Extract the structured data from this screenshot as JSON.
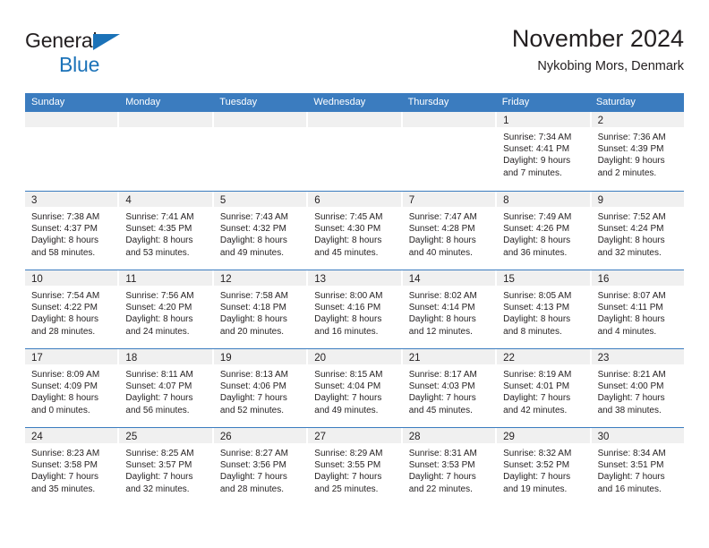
{
  "brand": {
    "name_top": "General",
    "name_bottom": "Blue",
    "triangle_color": "#1b72b8",
    "text_color": "#231f20"
  },
  "header": {
    "title": "November 2024",
    "subtitle": "Nykobing Mors, Denmark",
    "header_bg": "#3b7cbf",
    "header_text_color": "#ffffff",
    "day_band_bg": "#f0f0f0"
  },
  "weekdays": [
    "Sunday",
    "Monday",
    "Tuesday",
    "Wednesday",
    "Thursday",
    "Friday",
    "Saturday"
  ],
  "weeks": [
    [
      {
        "day": "",
        "empty": true
      },
      {
        "day": "",
        "empty": true
      },
      {
        "day": "",
        "empty": true
      },
      {
        "day": "",
        "empty": true
      },
      {
        "day": "",
        "empty": true
      },
      {
        "day": "1",
        "sunrise": "Sunrise: 7:34 AM",
        "sunset": "Sunset: 4:41 PM",
        "daylight1": "Daylight: 9 hours",
        "daylight2": "and 7 minutes."
      },
      {
        "day": "2",
        "sunrise": "Sunrise: 7:36 AM",
        "sunset": "Sunset: 4:39 PM",
        "daylight1": "Daylight: 9 hours",
        "daylight2": "and 2 minutes."
      }
    ],
    [
      {
        "day": "3",
        "sunrise": "Sunrise: 7:38 AM",
        "sunset": "Sunset: 4:37 PM",
        "daylight1": "Daylight: 8 hours",
        "daylight2": "and 58 minutes."
      },
      {
        "day": "4",
        "sunrise": "Sunrise: 7:41 AM",
        "sunset": "Sunset: 4:35 PM",
        "daylight1": "Daylight: 8 hours",
        "daylight2": "and 53 minutes."
      },
      {
        "day": "5",
        "sunrise": "Sunrise: 7:43 AM",
        "sunset": "Sunset: 4:32 PM",
        "daylight1": "Daylight: 8 hours",
        "daylight2": "and 49 minutes."
      },
      {
        "day": "6",
        "sunrise": "Sunrise: 7:45 AM",
        "sunset": "Sunset: 4:30 PM",
        "daylight1": "Daylight: 8 hours",
        "daylight2": "and 45 minutes."
      },
      {
        "day": "7",
        "sunrise": "Sunrise: 7:47 AM",
        "sunset": "Sunset: 4:28 PM",
        "daylight1": "Daylight: 8 hours",
        "daylight2": "and 40 minutes."
      },
      {
        "day": "8",
        "sunrise": "Sunrise: 7:49 AM",
        "sunset": "Sunset: 4:26 PM",
        "daylight1": "Daylight: 8 hours",
        "daylight2": "and 36 minutes."
      },
      {
        "day": "9",
        "sunrise": "Sunrise: 7:52 AM",
        "sunset": "Sunset: 4:24 PM",
        "daylight1": "Daylight: 8 hours",
        "daylight2": "and 32 minutes."
      }
    ],
    [
      {
        "day": "10",
        "sunrise": "Sunrise: 7:54 AM",
        "sunset": "Sunset: 4:22 PM",
        "daylight1": "Daylight: 8 hours",
        "daylight2": "and 28 minutes."
      },
      {
        "day": "11",
        "sunrise": "Sunrise: 7:56 AM",
        "sunset": "Sunset: 4:20 PM",
        "daylight1": "Daylight: 8 hours",
        "daylight2": "and 24 minutes."
      },
      {
        "day": "12",
        "sunrise": "Sunrise: 7:58 AM",
        "sunset": "Sunset: 4:18 PM",
        "daylight1": "Daylight: 8 hours",
        "daylight2": "and 20 minutes."
      },
      {
        "day": "13",
        "sunrise": "Sunrise: 8:00 AM",
        "sunset": "Sunset: 4:16 PM",
        "daylight1": "Daylight: 8 hours",
        "daylight2": "and 16 minutes."
      },
      {
        "day": "14",
        "sunrise": "Sunrise: 8:02 AM",
        "sunset": "Sunset: 4:14 PM",
        "daylight1": "Daylight: 8 hours",
        "daylight2": "and 12 minutes."
      },
      {
        "day": "15",
        "sunrise": "Sunrise: 8:05 AM",
        "sunset": "Sunset: 4:13 PM",
        "daylight1": "Daylight: 8 hours",
        "daylight2": "and 8 minutes."
      },
      {
        "day": "16",
        "sunrise": "Sunrise: 8:07 AM",
        "sunset": "Sunset: 4:11 PM",
        "daylight1": "Daylight: 8 hours",
        "daylight2": "and 4 minutes."
      }
    ],
    [
      {
        "day": "17",
        "sunrise": "Sunrise: 8:09 AM",
        "sunset": "Sunset: 4:09 PM",
        "daylight1": "Daylight: 8 hours",
        "daylight2": "and 0 minutes."
      },
      {
        "day": "18",
        "sunrise": "Sunrise: 8:11 AM",
        "sunset": "Sunset: 4:07 PM",
        "daylight1": "Daylight: 7 hours",
        "daylight2": "and 56 minutes."
      },
      {
        "day": "19",
        "sunrise": "Sunrise: 8:13 AM",
        "sunset": "Sunset: 4:06 PM",
        "daylight1": "Daylight: 7 hours",
        "daylight2": "and 52 minutes."
      },
      {
        "day": "20",
        "sunrise": "Sunrise: 8:15 AM",
        "sunset": "Sunset: 4:04 PM",
        "daylight1": "Daylight: 7 hours",
        "daylight2": "and 49 minutes."
      },
      {
        "day": "21",
        "sunrise": "Sunrise: 8:17 AM",
        "sunset": "Sunset: 4:03 PM",
        "daylight1": "Daylight: 7 hours",
        "daylight2": "and 45 minutes."
      },
      {
        "day": "22",
        "sunrise": "Sunrise: 8:19 AM",
        "sunset": "Sunset: 4:01 PM",
        "daylight1": "Daylight: 7 hours",
        "daylight2": "and 42 minutes."
      },
      {
        "day": "23",
        "sunrise": "Sunrise: 8:21 AM",
        "sunset": "Sunset: 4:00 PM",
        "daylight1": "Daylight: 7 hours",
        "daylight2": "and 38 minutes."
      }
    ],
    [
      {
        "day": "24",
        "sunrise": "Sunrise: 8:23 AM",
        "sunset": "Sunset: 3:58 PM",
        "daylight1": "Daylight: 7 hours",
        "daylight2": "and 35 minutes."
      },
      {
        "day": "25",
        "sunrise": "Sunrise: 8:25 AM",
        "sunset": "Sunset: 3:57 PM",
        "daylight1": "Daylight: 7 hours",
        "daylight2": "and 32 minutes."
      },
      {
        "day": "26",
        "sunrise": "Sunrise: 8:27 AM",
        "sunset": "Sunset: 3:56 PM",
        "daylight1": "Daylight: 7 hours",
        "daylight2": "and 28 minutes."
      },
      {
        "day": "27",
        "sunrise": "Sunrise: 8:29 AM",
        "sunset": "Sunset: 3:55 PM",
        "daylight1": "Daylight: 7 hours",
        "daylight2": "and 25 minutes."
      },
      {
        "day": "28",
        "sunrise": "Sunrise: 8:31 AM",
        "sunset": "Sunset: 3:53 PM",
        "daylight1": "Daylight: 7 hours",
        "daylight2": "and 22 minutes."
      },
      {
        "day": "29",
        "sunrise": "Sunrise: 8:32 AM",
        "sunset": "Sunset: 3:52 PM",
        "daylight1": "Daylight: 7 hours",
        "daylight2": "and 19 minutes."
      },
      {
        "day": "30",
        "sunrise": "Sunrise: 8:34 AM",
        "sunset": "Sunset: 3:51 PM",
        "daylight1": "Daylight: 7 hours",
        "daylight2": "and 16 minutes."
      }
    ]
  ]
}
